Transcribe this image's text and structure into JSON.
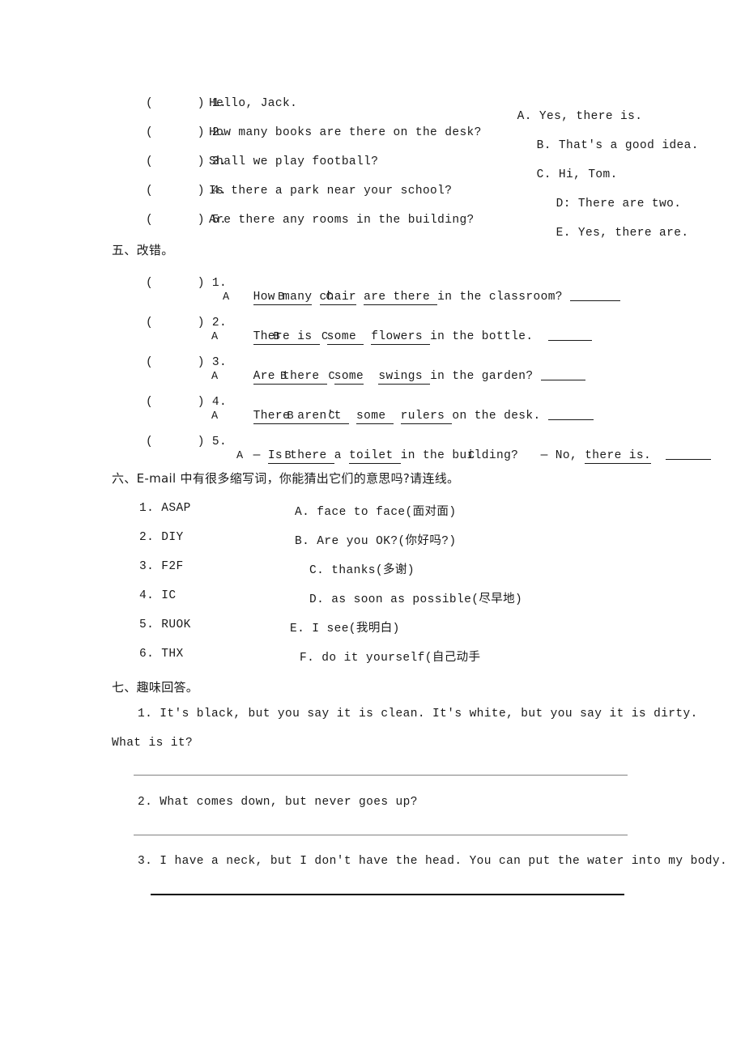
{
  "matching_exercise": {
    "left_items": [
      {
        "bracket": "(      ) 1.",
        "text": "Hello, Jack."
      },
      {
        "bracket": "(      ) 2.",
        "text": "How many books are there on the desk?"
      },
      {
        "bracket": "(      ) 3.",
        "text": "Shall we play football?"
      },
      {
        "bracket": "(      ) 4.",
        "text": "Is there a park near your school?"
      },
      {
        "bracket": "(      ) 5.",
        "text": "Are there any rooms in the building?"
      }
    ],
    "right_options": [
      {
        "label": "A.",
        "text": "Yes, there is."
      },
      {
        "label": "B.",
        "text": "That's a good idea."
      },
      {
        "label": "C.",
        "text": "Hi, Tom."
      },
      {
        "label": "D:",
        "text": "There are two."
      },
      {
        "label": "E.",
        "text": "Yes, there are."
      }
    ]
  },
  "section_five": {
    "heading": "五、改错。",
    "items": [
      {
        "bracket": "(      ) 1.",
        "parts": [
          {
            "text": "How many",
            "underline": true
          },
          {
            "text": " ",
            "underline": false
          },
          {
            "text": "chair",
            "underline": true
          },
          {
            "text": " ",
            "underline": false
          },
          {
            "text": "are there ",
            "underline": true
          },
          {
            "text": "in the classroom? ",
            "underline": false
          }
        ],
        "marks": "A       B      C"
      },
      {
        "bracket": "(      ) 2.",
        "parts": [
          {
            "text": "There is ",
            "underline": true
          },
          {
            "text": " ",
            "underline": false
          },
          {
            "text": "some ",
            "underline": true
          },
          {
            "text": " ",
            "underline": false
          },
          {
            "text": "flowers ",
            "underline": true
          },
          {
            "text": "in the bottle.  ",
            "underline": false
          }
        ],
        "marks": "A        B      C"
      },
      {
        "bracket": "(      ) 3.",
        "parts": [
          {
            "text": "Are there ",
            "underline": true
          },
          {
            "text": " ",
            "underline": false
          },
          {
            "text": "some",
            "underline": true
          },
          {
            "text": "  ",
            "underline": false
          },
          {
            "text": "swings ",
            "underline": true
          },
          {
            "text": "in the garden? ",
            "underline": false
          }
        ],
        "marks": "A         B      C"
      },
      {
        "bracket": "(      ) 4.",
        "parts": [
          {
            "text": "There aren't ",
            "underline": true
          },
          {
            "text": " ",
            "underline": false
          },
          {
            "text": "some ",
            "underline": true
          },
          {
            "text": " ",
            "underline": false
          },
          {
            "text": "rulers ",
            "underline": true
          },
          {
            "text": "on the desk. ",
            "underline": false
          }
        ],
        "marks": "A          B     C"
      },
      {
        "bracket": "(      ) 5.",
        "parts": [
          {
            "text": "— ",
            "underline": false
          },
          {
            "text": "Is there ",
            "underline": true
          },
          {
            "text": "a ",
            "underline": false
          },
          {
            "text": "toilet ",
            "underline": true
          },
          {
            "text": "in the building?   — No, ",
            "underline": false
          },
          {
            "text": "there is.",
            "underline": true
          },
          {
            "text": "  ",
            "underline": false
          }
        ],
        "marks": "A      B"
      }
    ],
    "item5_mark_c": "C"
  },
  "section_six": {
    "heading": "六、E-mail 中有很多缩写词，你能猜出它们的意思吗?请连线。",
    "left_items": [
      "1. ASAP",
      "2. DIY",
      "3. F2F",
      "4. IC",
      "5. RUOK",
      "6. THX"
    ],
    "right_items": [
      "A. face to face(面对面)",
      "B. Are you OK?(你好吗?)",
      "C. thanks(多谢)",
      "D. as soon as possible(尽早地)",
      "E. I see(我明白)",
      "F. do it yourself(自己动手"
    ]
  },
  "section_seven": {
    "heading": "七、趣味回答。",
    "q1_line1": "1. It's black, but you say it is clean. It's white, but you say it is dirty.",
    "q1_line2": "What is it?",
    "q2": "2. What comes down, but never goes up?",
    "q3": "3. I have a neck, but I don't have the head. You can put the water into my body."
  }
}
